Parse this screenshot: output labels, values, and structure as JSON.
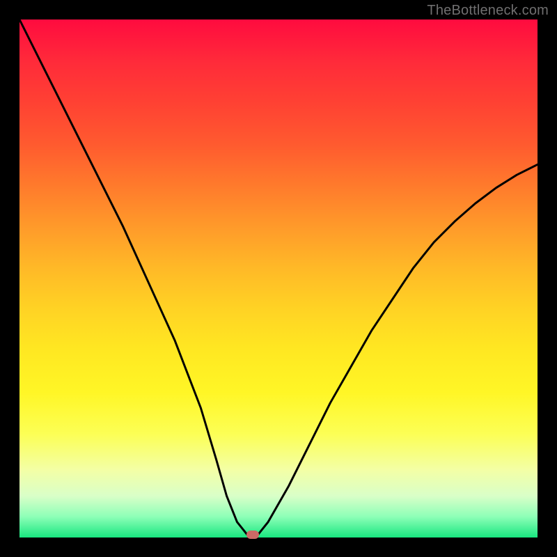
{
  "watermark": "TheBottleneck.com",
  "chart_data": {
    "type": "line",
    "title": "",
    "xlabel": "",
    "ylabel": "",
    "xlim": [
      0,
      100
    ],
    "ylim": [
      0,
      100
    ],
    "series": [
      {
        "name": "curve",
        "x": [
          0,
          5,
          10,
          15,
          20,
          25,
          30,
          35,
          38,
          40,
          42,
          44,
          46,
          48,
          52,
          56,
          60,
          64,
          68,
          72,
          76,
          80,
          84,
          88,
          92,
          96,
          100
        ],
        "y": [
          100,
          90,
          80,
          70,
          60,
          49,
          38,
          25,
          15,
          8,
          3,
          0.5,
          0.5,
          3,
          10,
          18,
          26,
          33,
          40,
          46,
          52,
          57,
          61,
          64.5,
          67.5,
          70,
          72
        ]
      }
    ],
    "marker": {
      "x": 45,
      "y": 0.5,
      "color": "#cc6a66"
    },
    "background_gradient": [
      "#ff0b3f",
      "#ffe822",
      "#18e780"
    ]
  }
}
